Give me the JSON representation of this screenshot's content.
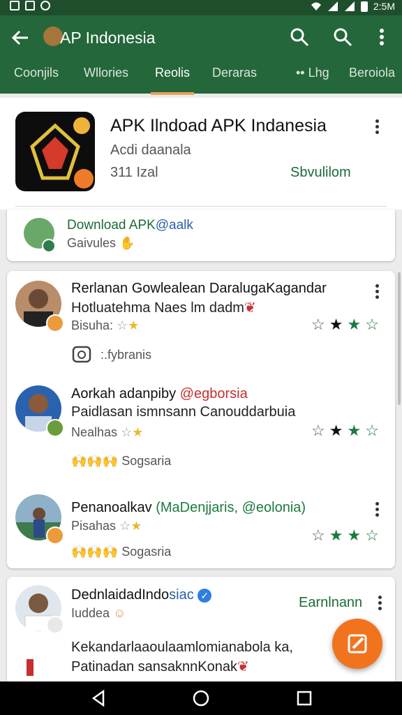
{
  "status_bar": {
    "time": "2:5M"
  },
  "app_bar": {
    "title": "AP Indonesia"
  },
  "tabs": [
    {
      "label": "Coonjils"
    },
    {
      "label": "Wllories"
    },
    {
      "label": "Reolis"
    },
    {
      "label": "Deraras"
    },
    {
      "label": "•• Lhg"
    },
    {
      "label": "Beroiola"
    }
  ],
  "app_header": {
    "title": "APK Ilndoad APK Indanesia",
    "subtitle": "Acdi daanala",
    "size": "311 Izal",
    "link": "Sbvulilom"
  },
  "download_card": {
    "title_green": "Download APK",
    "title_blue": "@aalk",
    "sub": "Gaivules"
  },
  "reviews": [
    {
      "name": "Rerlanan Gowlealean DaralugaKagandar",
      "text": "Hotluatehma Naes lm dadm",
      "meta": "Bisuha:",
      "footer": ":.fybranis",
      "stars": [
        "empty",
        "black",
        "green",
        "empty"
      ]
    },
    {
      "name_black": "Aorkah adanpiby",
      "name_red": "@egborsia",
      "text": "Paidlasan ismnsann Canouddarbuia",
      "meta": "Nealhas",
      "footer": "Sogsaria",
      "stars": [
        "empty",
        "black",
        "green",
        "empty"
      ]
    },
    {
      "name_black": "Penanoalkav",
      "name_green": "MaDenjjaris, @eolonia)",
      "name_open": "(",
      "meta": "Pisahas",
      "footer": "Sogasria",
      "stars": [
        "empty",
        "green",
        "green",
        "empty"
      ]
    },
    {
      "name_black": "DednlaidadIndo",
      "name_blue": "siac",
      "meta": "Iuddea",
      "link": "Earnlnann",
      "text1": "Kekandarlaaoulaamlomianabola ka,",
      "text2": "Patinadan sansaknnKonak"
    }
  ],
  "colors": {
    "primary": "#24673a",
    "status": "#1f4e2c",
    "accent": "#f2731e",
    "tab_indicator": "#e9a25c",
    "star_green": "#1d7a3e"
  },
  "icons": [
    "back-arrow-icon",
    "search-icon",
    "more-vert-icon",
    "camera-icon",
    "verified-icon",
    "fab-edit-icon",
    "nav-back-icon",
    "nav-home-icon",
    "nav-recents-icon"
  ]
}
